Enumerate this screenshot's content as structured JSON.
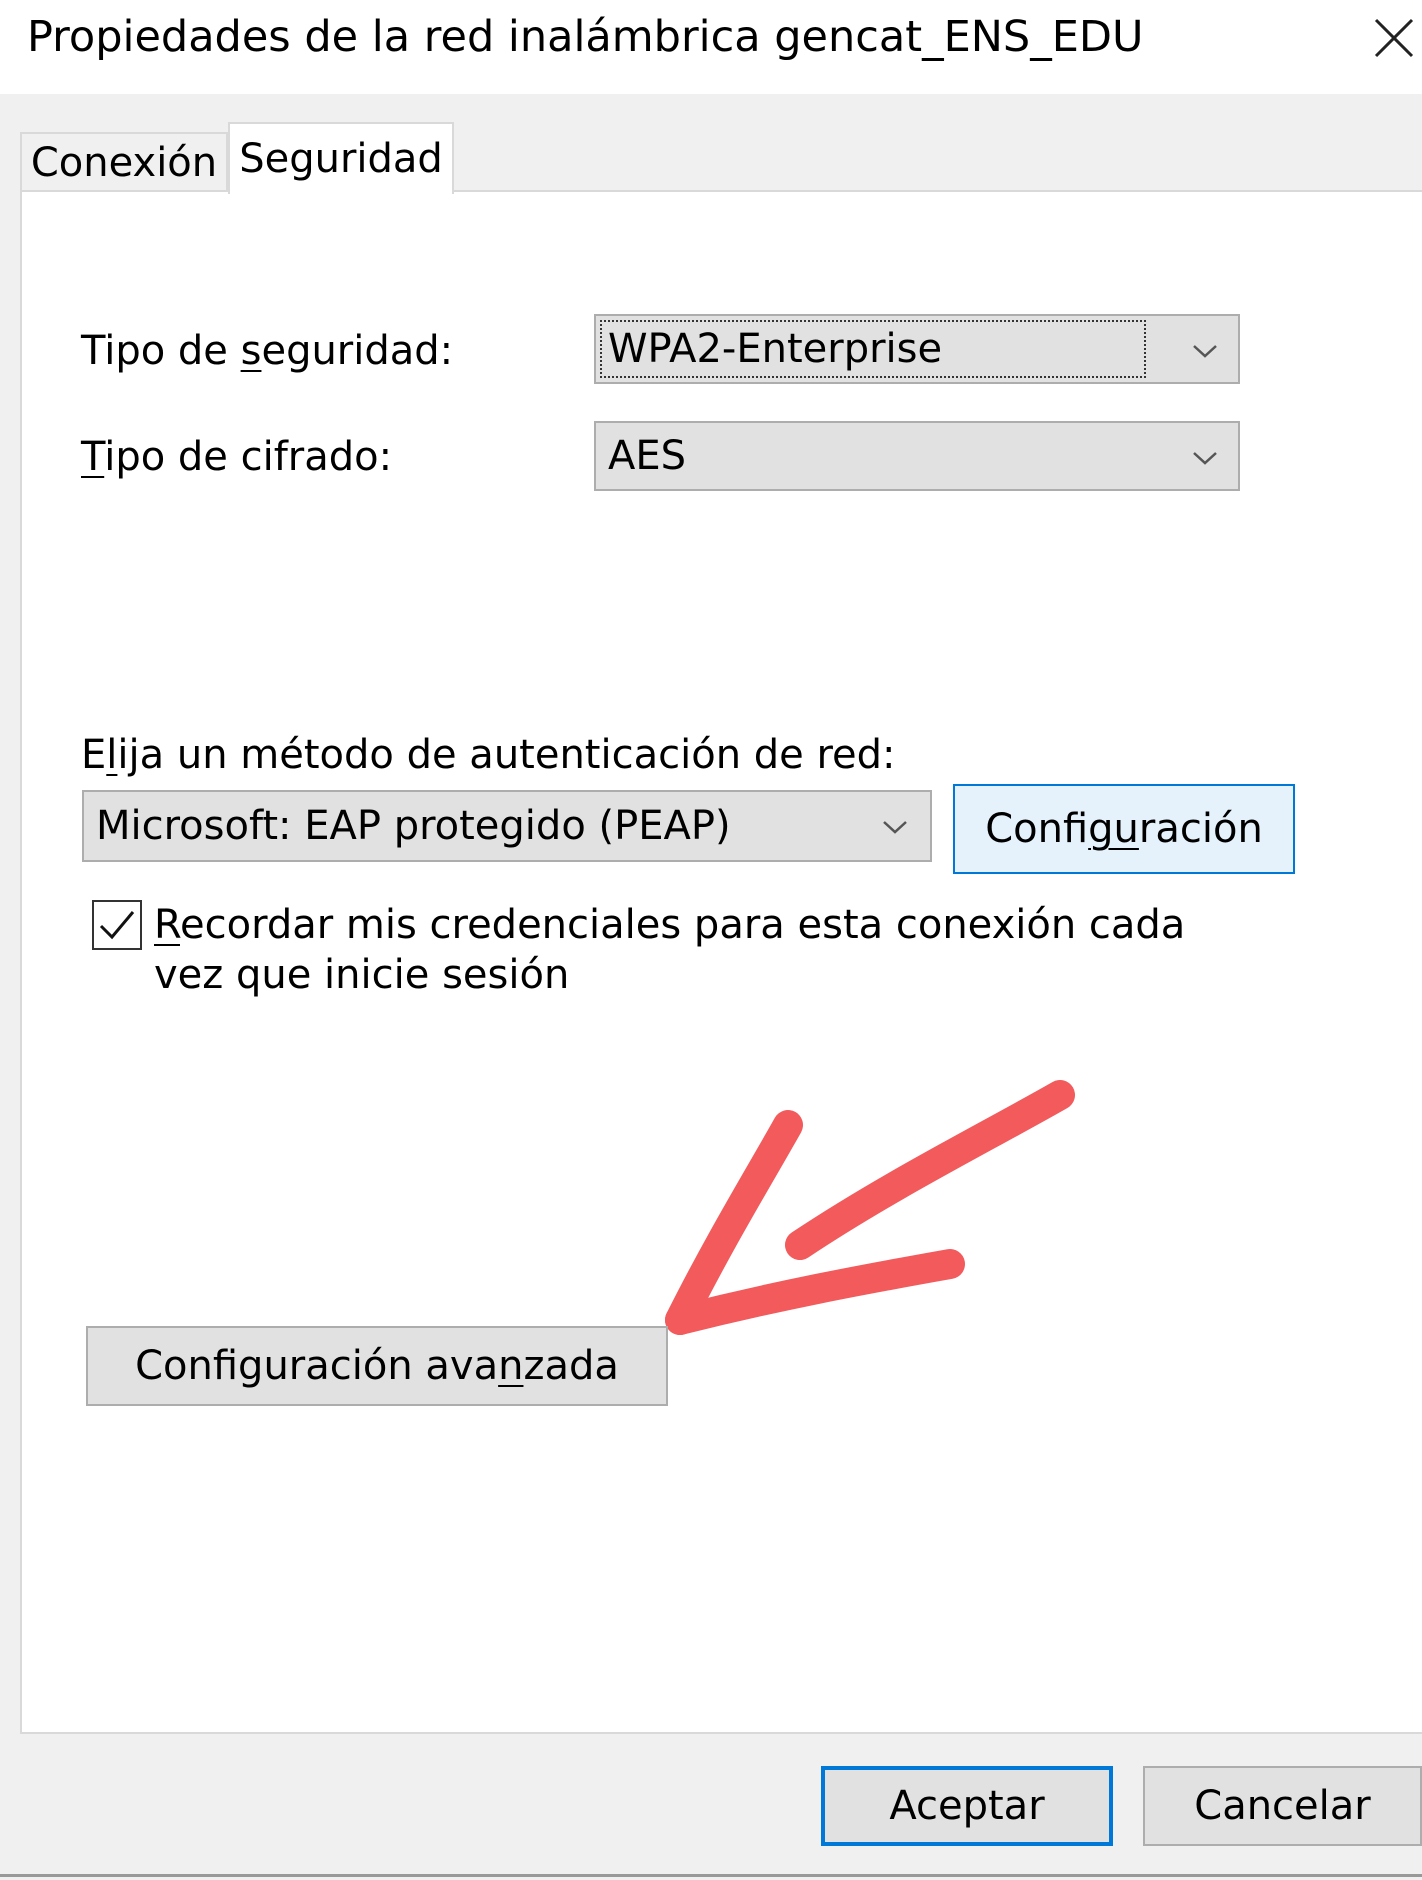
{
  "window": {
    "title": "Propiedades de la red inalámbrica gencat_ENS_EDU"
  },
  "tabs": [
    {
      "label": "Conexión",
      "active": false
    },
    {
      "label": "Seguridad",
      "active": true
    }
  ],
  "security": {
    "security_type_label_pre": "Tipo de ",
    "security_type_label_u": "s",
    "security_type_label_post": "eguridad:",
    "security_type_value": "WPA2-Enterprise",
    "encryption_type_label_u": "T",
    "encryption_type_label_post": "ipo de cifrado:",
    "encryption_type_value": "AES"
  },
  "auth": {
    "method_label_pre": "E",
    "method_label_u": "l",
    "method_label_post": "ija un método de autenticación de red:",
    "method_value": "Microsoft: EAP protegido (PEAP)",
    "config_button_pre": "Confi",
    "config_button_u": "gu",
    "config_button_post": "ración",
    "remember_checked": true,
    "remember_label_u": "R",
    "remember_label_line1": "ecordar mis credenciales para esta conexión cada",
    "remember_label_line2": "vez que inicie sesión"
  },
  "advanced": {
    "button_pre": "Configuración ava",
    "button_u": "n",
    "button_post": "zada"
  },
  "footer": {
    "ok_label": "Aceptar",
    "cancel_label": "Cancelar"
  },
  "colors": {
    "accent": "#0078d7",
    "annotation_arrow": "#f25a5c"
  },
  "icons": {
    "close": "close-icon",
    "dropdown": "chevron-down-icon",
    "check": "checkmark-icon",
    "annotation": "arrow-icon"
  }
}
